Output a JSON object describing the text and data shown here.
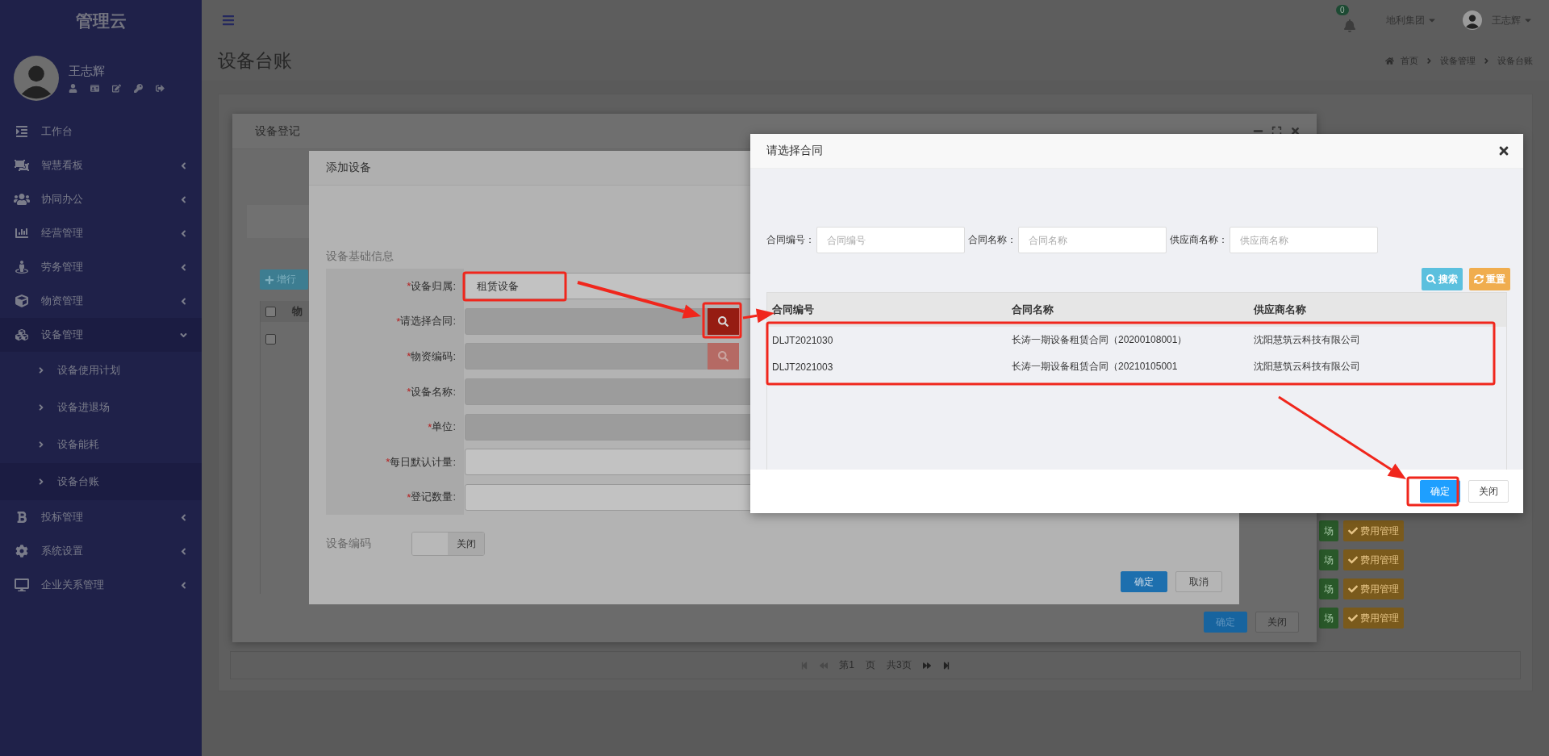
{
  "sidebar": {
    "logo": "管理云",
    "user_name": "王志辉",
    "menu": [
      {
        "label": "工作台",
        "kind": "link"
      },
      {
        "label": "智慧看板",
        "kind": "group",
        "expanded": false
      },
      {
        "label": "协同办公",
        "kind": "group",
        "expanded": false
      },
      {
        "label": "经营管理",
        "kind": "group",
        "expanded": false
      },
      {
        "label": "劳务管理",
        "kind": "group",
        "expanded": false
      },
      {
        "label": "物资管理",
        "kind": "group",
        "expanded": false
      },
      {
        "label": "设备管理",
        "kind": "group",
        "expanded": true,
        "children": [
          {
            "label": "设备使用计划",
            "selected": false
          },
          {
            "label": "设备进退场",
            "selected": false
          },
          {
            "label": "设备能耗",
            "selected": false
          },
          {
            "label": "设备台账",
            "selected": true
          }
        ]
      },
      {
        "label": "投标管理",
        "kind": "group",
        "expanded": false
      },
      {
        "label": "系统设置",
        "kind": "group",
        "expanded": false
      },
      {
        "label": "企业关系管理",
        "kind": "group",
        "expanded": false
      }
    ]
  },
  "header": {
    "notification_count": "0",
    "company": "地利集团",
    "user_name": "王志辉"
  },
  "page": {
    "title": "设备台账",
    "breadcrumb": [
      "首页",
      "设备管理",
      "设备台账"
    ],
    "background_rows": [
      {
        "tags": [
          "场",
          "费用管理"
        ]
      },
      {
        "tags": [
          "场",
          "费用管理"
        ]
      },
      {
        "tags": [
          "场",
          "费用管理"
        ]
      },
      {
        "tags": [
          "场",
          "费用管理"
        ]
      }
    ],
    "pagination": {
      "prefix": "第",
      "current": "1",
      "suffix": "页",
      "total": "共3页"
    }
  },
  "register_dialog": {
    "title": "设备登记",
    "add_row_button": "增行",
    "table": {
      "header_checked": false,
      "column_1": "物",
      "rows": [
        {
          "checked": false
        }
      ]
    },
    "buttons": [
      {
        "label": "确定",
        "kind": "primary"
      },
      {
        "label": "关闭",
        "kind": "default"
      }
    ]
  },
  "add_dialog": {
    "title": "添加设备",
    "section": "设备基础信息",
    "fields": [
      {
        "required_mark": "*",
        "label": "设备归属:",
        "kind": "select",
        "value": "租赁设备",
        "readonly": false
      },
      {
        "required_mark": "*",
        "label": "请选择合同:",
        "kind": "lookup",
        "readonly": true,
        "button_active": true
      },
      {
        "required_mark": "*",
        "label": "物资编码:",
        "kind": "lookup",
        "readonly": true,
        "button_active": false
      },
      {
        "required_mark": "*",
        "label": "设备名称:",
        "kind": "text",
        "readonly": true
      },
      {
        "required_mark": "*",
        "label": "单位:",
        "kind": "text",
        "readonly": true
      },
      {
        "required_mark": "*",
        "label": "每日默认计量:",
        "kind": "text",
        "readonly": false
      },
      {
        "required_mark": "*",
        "label": "登记数量:",
        "kind": "text",
        "readonly": false
      }
    ],
    "code_toggle": {
      "label": "设备编码",
      "on": false,
      "text": "关闭"
    },
    "buttons": [
      {
        "label": "确定",
        "kind": "primary"
      },
      {
        "label": "取消",
        "kind": "default"
      }
    ]
  },
  "contract_dialog": {
    "title": "请选择合同",
    "filters": [
      {
        "label": "合同编号：",
        "placeholder": "合同编号"
      },
      {
        "label": "合同名称：",
        "placeholder": "合同名称"
      },
      {
        "label": "供应商名称：",
        "placeholder": "供应商名称"
      }
    ],
    "actions": [
      {
        "label": "搜索",
        "kind": "search"
      },
      {
        "label": "重置",
        "kind": "reset"
      }
    ],
    "table": {
      "columns": [
        "合同编号",
        "合同名称",
        "供应商名称"
      ],
      "rows": [
        [
          "DLJT2021030",
          "长涛一期设备租赁合同（20200108001）",
          "沈阳慧筑云科技有限公司"
        ],
        [
          "DLJT2021003",
          "长涛一期设备租赁合同（20210105001",
          "沈阳慧筑云科技有限公司"
        ]
      ]
    },
    "buttons": [
      {
        "label": "确定",
        "kind": "primary"
      },
      {
        "label": "关闭",
        "kind": "default"
      }
    ]
  }
}
